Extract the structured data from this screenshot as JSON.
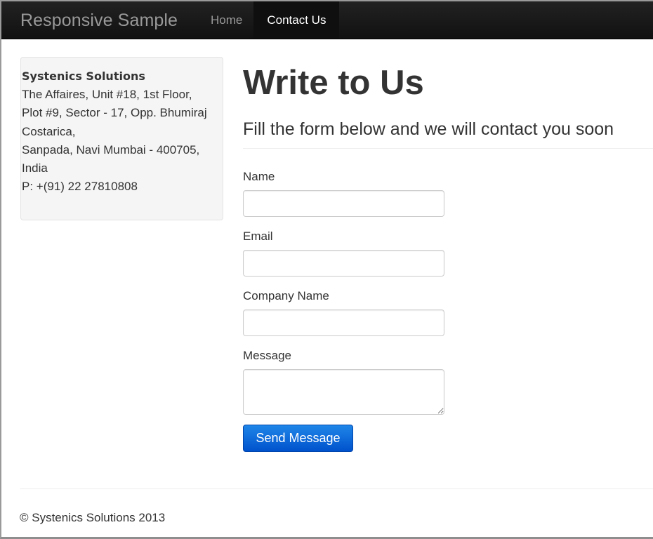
{
  "navbar": {
    "brand": "Responsive Sample",
    "items": [
      {
        "label": "Home",
        "active": false
      },
      {
        "label": "Contact Us",
        "active": true
      }
    ]
  },
  "address": {
    "company": "Systenics Solutions",
    "lines": [
      "The Affaires, Unit #18, 1st Floor,",
      "Plot #9, Sector - 17, Opp. Bhumiraj",
      "Costarica,",
      "Sanpada, Navi Mumbai - 400705,",
      "India",
      "P: +(91) 22 27810808"
    ]
  },
  "main": {
    "title": "Write to Us",
    "subtitle": "Fill the form below and we will contact you soon",
    "form": {
      "fields": [
        {
          "label": "Name",
          "value": "",
          "placeholder": ""
        },
        {
          "label": "Email",
          "value": "",
          "placeholder": ""
        },
        {
          "label": "Company Name",
          "value": "",
          "placeholder": ""
        },
        {
          "label": "Message",
          "value": "",
          "placeholder": ""
        }
      ],
      "submit_label": "Send Message"
    }
  },
  "footer": {
    "copyright": "© Systenics Solutions 2013"
  },
  "colors": {
    "navbar_bg": "#1b1b1b",
    "primary_button": "#0068d8",
    "well_bg": "#f5f5f5",
    "text": "#333333"
  }
}
